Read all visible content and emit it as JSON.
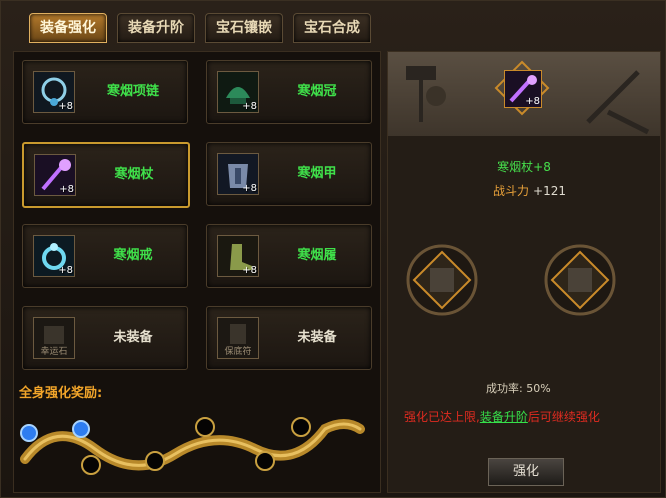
{
  "tabs": [
    {
      "label": "装备强化",
      "active": true
    },
    {
      "label": "装备升阶",
      "active": false
    },
    {
      "label": "宝石镶嵌",
      "active": false
    },
    {
      "label": "宝石合成",
      "active": false
    }
  ],
  "equipment": [
    {
      "name": "寒烟项链",
      "level": "+8",
      "icon": "necklace-icon"
    },
    {
      "name": "寒烟冠",
      "level": "+8",
      "icon": "helmet-icon"
    },
    {
      "name": "寒烟杖",
      "level": "+8",
      "icon": "staff-icon",
      "selected": true
    },
    {
      "name": "寒烟甲",
      "level": "+8",
      "icon": "armor-icon"
    },
    {
      "name": "寒烟戒",
      "level": "+8",
      "icon": "ring-icon"
    },
    {
      "name": "寒烟履",
      "level": "+8",
      "icon": "boots-icon"
    },
    {
      "name": "未装备",
      "icon_label": "幸运石",
      "icon": "lucky-stone-icon"
    },
    {
      "name": "未装备",
      "icon_label": "保底符",
      "icon": "guarantee-charm-icon"
    }
  ],
  "bonus_label": "全身强化奖励:",
  "detail": {
    "item_level": "+8",
    "item_name": "寒烟杖+8",
    "power_label": "战斗力",
    "power_value": "+121",
    "success_rate": "成功率: 50%",
    "warn_prefix": "强化已达上限,",
    "warn_link": "装备升阶",
    "warn_suffix": "后可继续强化",
    "button_label": "强化"
  },
  "colors": {
    "item_green": "#46e04c",
    "warning_red": "#e02b20",
    "power_orange": "#e8a13a",
    "active_tab": "#b47a2c"
  }
}
